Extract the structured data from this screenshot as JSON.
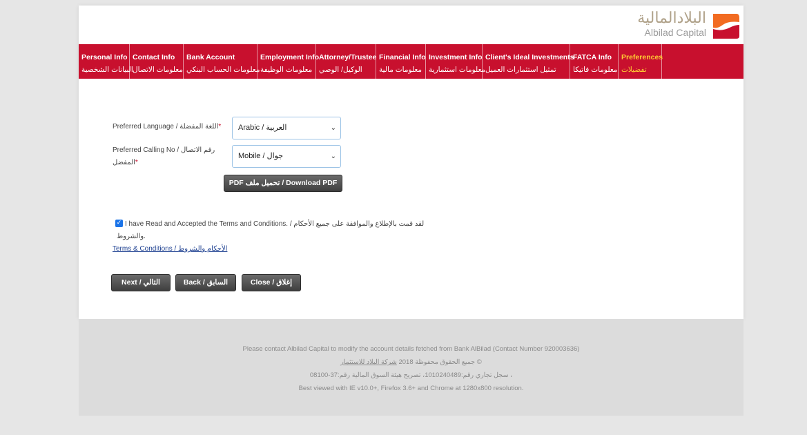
{
  "branding": {
    "logo_arabic": "البلادالمالية",
    "logo_latin": "Albilad Capital",
    "colors": {
      "primary": "#c8102e",
      "active_tab": "#ffcc33",
      "logo_orange": "#f26b21"
    }
  },
  "nav": {
    "items": [
      {
        "en": "Personal Info",
        "ar": "البيانات الشخصية"
      },
      {
        "en": "Contact Info",
        "ar": "معلومات الاتصال"
      },
      {
        "en": "Bank Account",
        "ar": "معلومات الحساب البنكي"
      },
      {
        "en": "Employment Info",
        "ar": "معلومات الوظيفة"
      },
      {
        "en": "Attorney/Trustee",
        "ar": "الوكيل/ الوصي"
      },
      {
        "en": "Financial Info",
        "ar": "معلومات مالية"
      },
      {
        "en": "Investment Info",
        "ar": "معلومات استثمارية"
      },
      {
        "en": "Client's Ideal Investments",
        "ar": "تمثيل استثمارات العميل"
      },
      {
        "en": "FATCA Info",
        "ar": "معلومات فاتيكا"
      },
      {
        "en": "Preferences",
        "ar": "تفضيلات"
      }
    ],
    "active_index": 9
  },
  "form": {
    "language": {
      "label": "Preferred Language / اللغة المفضلة",
      "value": "Arabic / العربية"
    },
    "calling": {
      "label_line1": "Preferred Calling No / رقم الاتصال",
      "label_line2": "المفضل",
      "value": "Mobile / جوال"
    },
    "download_pdf": "PDF تحميل ملف / Download PDF"
  },
  "terms": {
    "checked": true,
    "text_line1": "I have Read and Accepted the Terms and Conditions. / لقد قمت بالإطلاع والموافقة على جميع الأحكام",
    "text_line2": "والشروط.",
    "link": "Terms & Conditions / الأحكام والشروط"
  },
  "buttons": {
    "next": "Next / التالي",
    "back": "Back / السابق",
    "close": "Close / إغلاق"
  },
  "footer": {
    "contact": "Please contact Albilad Capital to modify the account details fetched from Bank AlBilad (Contact Number 920003636)",
    "copyright_prefix": "جميع الحقوق محفوظة 2018 ",
    "copyright_link": "شركة البلاد للاستثمار",
    "copyright_symbol": " ©",
    "registration": "سجل تجاري رقم:1010240489، تصريح هيئة السوق المالية رقم:37-08100 ،",
    "browser": "Best viewed with IE v10.0+, Firefox 3.6+ and Chrome at 1280x800 resolution."
  }
}
